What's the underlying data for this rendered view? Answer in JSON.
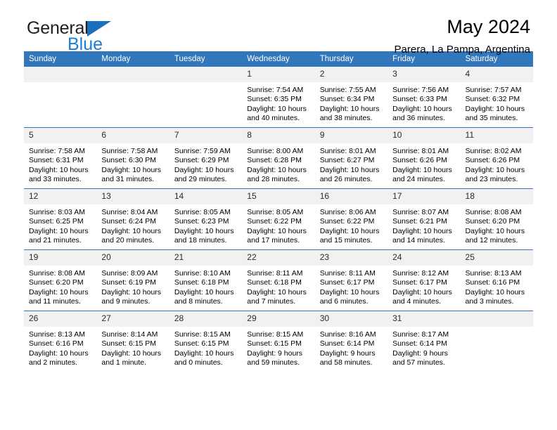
{
  "brand": {
    "name_part1": "General",
    "name_part2": "Blue",
    "triangle_icon": "triangle-icon",
    "accent_dark": "#231f20",
    "accent_blue": "#1c7fd6",
    "triangle_blue": "#1c6fba"
  },
  "header": {
    "title": "May 2024",
    "location": "Parera, La Pampa, Argentina"
  },
  "theme": {
    "header_bg": "#3277bb",
    "header_text": "#ffffff",
    "daynum_bg": "#f1f1f1",
    "row_divider": "#3277bb"
  },
  "weekday_headers": [
    "Sunday",
    "Monday",
    "Tuesday",
    "Wednesday",
    "Thursday",
    "Friday",
    "Saturday"
  ],
  "weeks": [
    [
      {
        "day": "",
        "empty": true,
        "sunrise": "",
        "sunset": "",
        "daylight1": "",
        "daylight2": ""
      },
      {
        "day": "",
        "empty": true,
        "sunrise": "",
        "sunset": "",
        "daylight1": "",
        "daylight2": ""
      },
      {
        "day": "",
        "empty": true,
        "sunrise": "",
        "sunset": "",
        "daylight1": "",
        "daylight2": ""
      },
      {
        "day": "1",
        "sunrise": "Sunrise: 7:54 AM",
        "sunset": "Sunset: 6:35 PM",
        "daylight1": "Daylight: 10 hours",
        "daylight2": "and 40 minutes."
      },
      {
        "day": "2",
        "sunrise": "Sunrise: 7:55 AM",
        "sunset": "Sunset: 6:34 PM",
        "daylight1": "Daylight: 10 hours",
        "daylight2": "and 38 minutes."
      },
      {
        "day": "3",
        "sunrise": "Sunrise: 7:56 AM",
        "sunset": "Sunset: 6:33 PM",
        "daylight1": "Daylight: 10 hours",
        "daylight2": "and 36 minutes."
      },
      {
        "day": "4",
        "sunrise": "Sunrise: 7:57 AM",
        "sunset": "Sunset: 6:32 PM",
        "daylight1": "Daylight: 10 hours",
        "daylight2": "and 35 minutes."
      }
    ],
    [
      {
        "day": "5",
        "sunrise": "Sunrise: 7:58 AM",
        "sunset": "Sunset: 6:31 PM",
        "daylight1": "Daylight: 10 hours",
        "daylight2": "and 33 minutes."
      },
      {
        "day": "6",
        "sunrise": "Sunrise: 7:58 AM",
        "sunset": "Sunset: 6:30 PM",
        "daylight1": "Daylight: 10 hours",
        "daylight2": "and 31 minutes."
      },
      {
        "day": "7",
        "sunrise": "Sunrise: 7:59 AM",
        "sunset": "Sunset: 6:29 PM",
        "daylight1": "Daylight: 10 hours",
        "daylight2": "and 29 minutes."
      },
      {
        "day": "8",
        "sunrise": "Sunrise: 8:00 AM",
        "sunset": "Sunset: 6:28 PM",
        "daylight1": "Daylight: 10 hours",
        "daylight2": "and 28 minutes."
      },
      {
        "day": "9",
        "sunrise": "Sunrise: 8:01 AM",
        "sunset": "Sunset: 6:27 PM",
        "daylight1": "Daylight: 10 hours",
        "daylight2": "and 26 minutes."
      },
      {
        "day": "10",
        "sunrise": "Sunrise: 8:01 AM",
        "sunset": "Sunset: 6:26 PM",
        "daylight1": "Daylight: 10 hours",
        "daylight2": "and 24 minutes."
      },
      {
        "day": "11",
        "sunrise": "Sunrise: 8:02 AM",
        "sunset": "Sunset: 6:26 PM",
        "daylight1": "Daylight: 10 hours",
        "daylight2": "and 23 minutes."
      }
    ],
    [
      {
        "day": "12",
        "sunrise": "Sunrise: 8:03 AM",
        "sunset": "Sunset: 6:25 PM",
        "daylight1": "Daylight: 10 hours",
        "daylight2": "and 21 minutes."
      },
      {
        "day": "13",
        "sunrise": "Sunrise: 8:04 AM",
        "sunset": "Sunset: 6:24 PM",
        "daylight1": "Daylight: 10 hours",
        "daylight2": "and 20 minutes."
      },
      {
        "day": "14",
        "sunrise": "Sunrise: 8:05 AM",
        "sunset": "Sunset: 6:23 PM",
        "daylight1": "Daylight: 10 hours",
        "daylight2": "and 18 minutes."
      },
      {
        "day": "15",
        "sunrise": "Sunrise: 8:05 AM",
        "sunset": "Sunset: 6:22 PM",
        "daylight1": "Daylight: 10 hours",
        "daylight2": "and 17 minutes."
      },
      {
        "day": "16",
        "sunrise": "Sunrise: 8:06 AM",
        "sunset": "Sunset: 6:22 PM",
        "daylight1": "Daylight: 10 hours",
        "daylight2": "and 15 minutes."
      },
      {
        "day": "17",
        "sunrise": "Sunrise: 8:07 AM",
        "sunset": "Sunset: 6:21 PM",
        "daylight1": "Daylight: 10 hours",
        "daylight2": "and 14 minutes."
      },
      {
        "day": "18",
        "sunrise": "Sunrise: 8:08 AM",
        "sunset": "Sunset: 6:20 PM",
        "daylight1": "Daylight: 10 hours",
        "daylight2": "and 12 minutes."
      }
    ],
    [
      {
        "day": "19",
        "sunrise": "Sunrise: 8:08 AM",
        "sunset": "Sunset: 6:20 PM",
        "daylight1": "Daylight: 10 hours",
        "daylight2": "and 11 minutes."
      },
      {
        "day": "20",
        "sunrise": "Sunrise: 8:09 AM",
        "sunset": "Sunset: 6:19 PM",
        "daylight1": "Daylight: 10 hours",
        "daylight2": "and 9 minutes."
      },
      {
        "day": "21",
        "sunrise": "Sunrise: 8:10 AM",
        "sunset": "Sunset: 6:18 PM",
        "daylight1": "Daylight: 10 hours",
        "daylight2": "and 8 minutes."
      },
      {
        "day": "22",
        "sunrise": "Sunrise: 8:11 AM",
        "sunset": "Sunset: 6:18 PM",
        "daylight1": "Daylight: 10 hours",
        "daylight2": "and 7 minutes."
      },
      {
        "day": "23",
        "sunrise": "Sunrise: 8:11 AM",
        "sunset": "Sunset: 6:17 PM",
        "daylight1": "Daylight: 10 hours",
        "daylight2": "and 6 minutes."
      },
      {
        "day": "24",
        "sunrise": "Sunrise: 8:12 AM",
        "sunset": "Sunset: 6:17 PM",
        "daylight1": "Daylight: 10 hours",
        "daylight2": "and 4 minutes."
      },
      {
        "day": "25",
        "sunrise": "Sunrise: 8:13 AM",
        "sunset": "Sunset: 6:16 PM",
        "daylight1": "Daylight: 10 hours",
        "daylight2": "and 3 minutes."
      }
    ],
    [
      {
        "day": "26",
        "sunrise": "Sunrise: 8:13 AM",
        "sunset": "Sunset: 6:16 PM",
        "daylight1": "Daylight: 10 hours",
        "daylight2": "and 2 minutes."
      },
      {
        "day": "27",
        "sunrise": "Sunrise: 8:14 AM",
        "sunset": "Sunset: 6:15 PM",
        "daylight1": "Daylight: 10 hours",
        "daylight2": "and 1 minute."
      },
      {
        "day": "28",
        "sunrise": "Sunrise: 8:15 AM",
        "sunset": "Sunset: 6:15 PM",
        "daylight1": "Daylight: 10 hours",
        "daylight2": "and 0 minutes."
      },
      {
        "day": "29",
        "sunrise": "Sunrise: 8:15 AM",
        "sunset": "Sunset: 6:15 PM",
        "daylight1": "Daylight: 9 hours",
        "daylight2": "and 59 minutes."
      },
      {
        "day": "30",
        "sunrise": "Sunrise: 8:16 AM",
        "sunset": "Sunset: 6:14 PM",
        "daylight1": "Daylight: 9 hours",
        "daylight2": "and 58 minutes."
      },
      {
        "day": "31",
        "sunrise": "Sunrise: 8:17 AM",
        "sunset": "Sunset: 6:14 PM",
        "daylight1": "Daylight: 9 hours",
        "daylight2": "and 57 minutes."
      },
      {
        "day": "",
        "empty": true,
        "sunrise": "",
        "sunset": "",
        "daylight1": "",
        "daylight2": ""
      }
    ]
  ]
}
